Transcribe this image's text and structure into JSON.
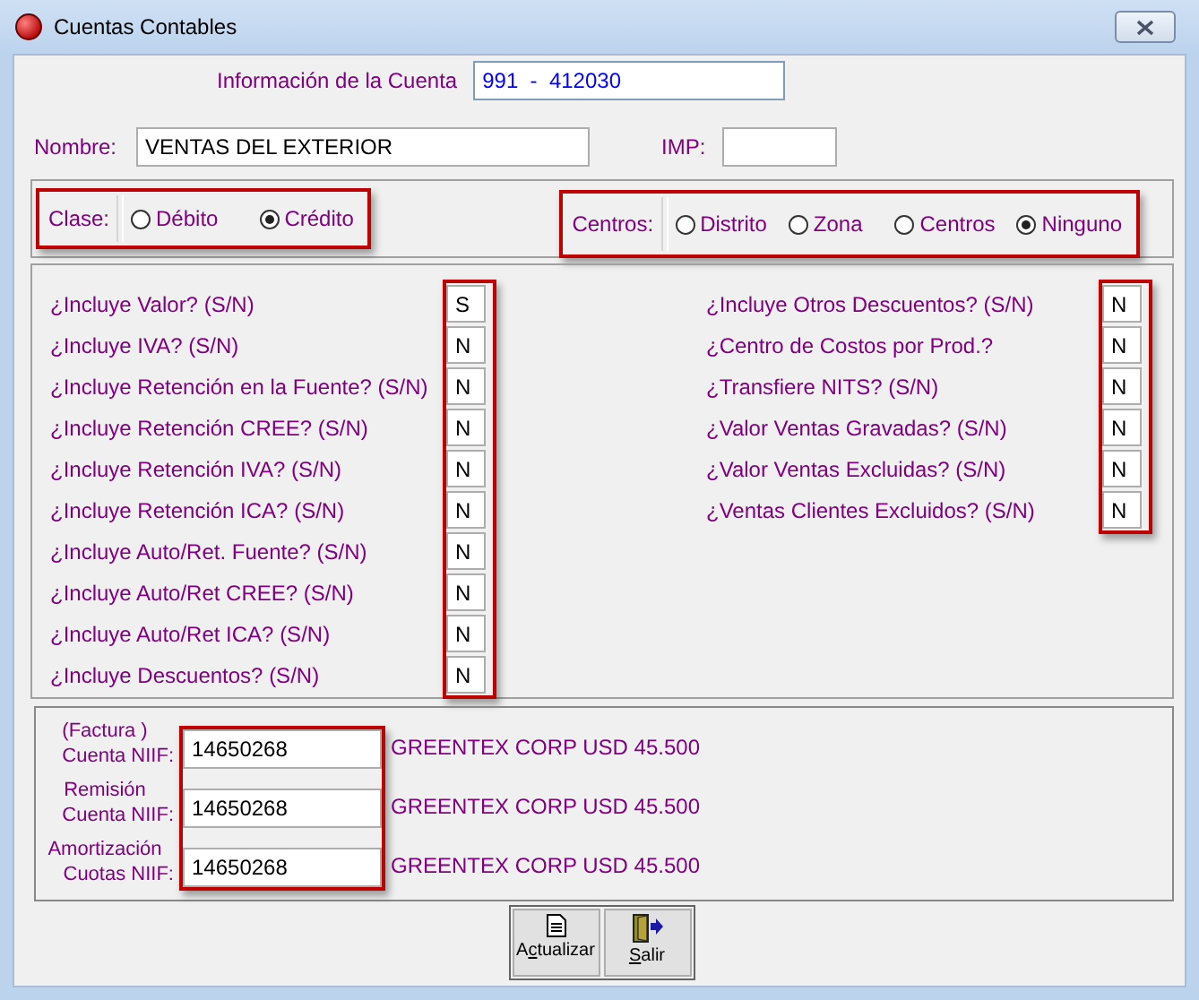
{
  "window": {
    "title": "Cuentas Contables"
  },
  "account": {
    "label": "Información de la Cuenta",
    "value": "991  -  412030"
  },
  "name": {
    "label": "Nombre:",
    "value": "VENTAS DEL EXTERIOR"
  },
  "imp": {
    "label": "IMP:"
  },
  "clase": {
    "label": "Clase:",
    "highlighted": true,
    "options": [
      {
        "label": "Débito",
        "selected": false
      },
      {
        "label": "Crédito",
        "selected": true
      }
    ]
  },
  "centros": {
    "label": "Centros:",
    "highlighted": true,
    "options": [
      {
        "label": "Distrito",
        "selected": false
      },
      {
        "label": "Zona",
        "selected": false
      },
      {
        "label": "Centros",
        "selected": false
      },
      {
        "label": "Ninguno",
        "selected": true
      }
    ]
  },
  "flags_left": {
    "highlighted": true,
    "items": [
      {
        "label": "¿Incluye Valor? (S/N)",
        "value": "S"
      },
      {
        "label": "¿Incluye IVA? (S/N)",
        "value": "N"
      },
      {
        "label": "¿Incluye Retención en la Fuente? (S/N)",
        "value": "N"
      },
      {
        "label": "¿Incluye Retención CREE? (S/N)",
        "value": "N"
      },
      {
        "label": "¿Incluye Retención IVA? (S/N)",
        "value": "N"
      },
      {
        "label": "¿Incluye Retención ICA? (S/N)",
        "value": "N"
      },
      {
        "label": "¿Incluye Auto/Ret. Fuente? (S/N)",
        "value": "N"
      },
      {
        "label": "¿Incluye Auto/Ret CREE? (S/N)",
        "value": "N"
      },
      {
        "label": "¿Incluye Auto/Ret ICA? (S/N)",
        "value": "N"
      },
      {
        "label": "¿Incluye Descuentos? (S/N)",
        "value": "N"
      }
    ]
  },
  "flags_right": {
    "highlighted": true,
    "items": [
      {
        "label": "¿Incluye Otros Descuentos? (S/N)",
        "value": "N"
      },
      {
        "label": "¿Centro de Costos por Prod.?",
        "value": "N"
      },
      {
        "label": "¿Transfiere NITS? (S/N)",
        "value": "N"
      },
      {
        "label": "¿Valor Ventas Gravadas? (S/N)",
        "value": "N"
      },
      {
        "label": "¿Valor Ventas Excluidas? (S/N)",
        "value": "N"
      },
      {
        "label": "¿Ventas Clientes Excluidos? (S/N)",
        "value": "N"
      }
    ]
  },
  "niif": {
    "highlighted": true,
    "rows": [
      {
        "label_lines": [
          "(Factura )",
          "Cuenta NIIF:"
        ],
        "value": "14650268",
        "description": "GREENTEX CORP USD 45.500"
      },
      {
        "label_lines": [
          "Remisión",
          "Cuenta NIIF:"
        ],
        "value": "14650268",
        "description": "GREENTEX CORP USD 45.500"
      },
      {
        "label_lines": [
          "Amortización",
          "Cuotas NIIF:"
        ],
        "value": "14650268",
        "description": "GREENTEX CORP USD 45.500"
      }
    ]
  },
  "buttons": [
    {
      "kind": "update",
      "before": "A",
      "key": "c",
      "after": "tualizar"
    },
    {
      "kind": "exit",
      "key": "S",
      "after": "alir"
    }
  ]
}
